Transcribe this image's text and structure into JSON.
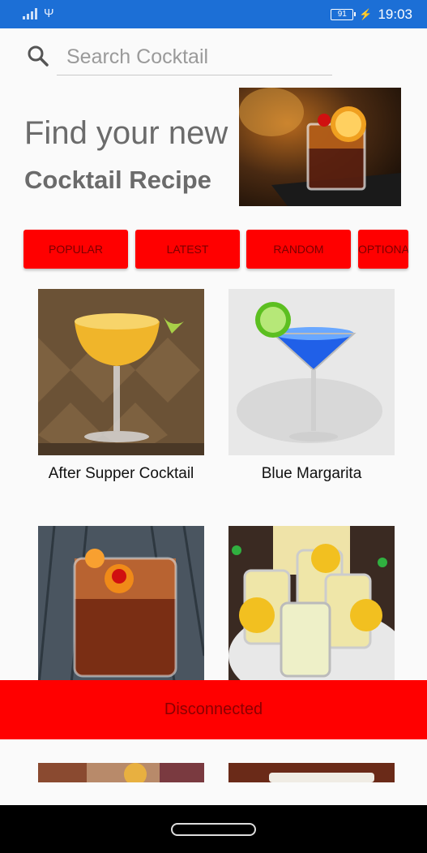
{
  "status_bar": {
    "battery": "91",
    "time": "19:03",
    "icons": [
      "signal-icon",
      "usb-icon",
      "battery-icon",
      "charging-icon"
    ]
  },
  "search": {
    "placeholder": "Search Cocktail",
    "value": "",
    "icon": "search-icon"
  },
  "hero": {
    "line1": "Find your new",
    "line2": "Cocktail Recipe"
  },
  "categories": [
    "POPULAR",
    "LATEST",
    "RANDOM",
    "OPTIONAL"
  ],
  "cocktails": [
    {
      "name": "After Supper Cocktail"
    },
    {
      "name": "Blue Margarita"
    },
    {
      "name": ""
    },
    {
      "name": ""
    }
  ],
  "banner": {
    "text": "Disconnected"
  },
  "colors": {
    "status_bar": "#1c6fd6",
    "accent_red": "#ff0000",
    "background": "#fafafa"
  }
}
